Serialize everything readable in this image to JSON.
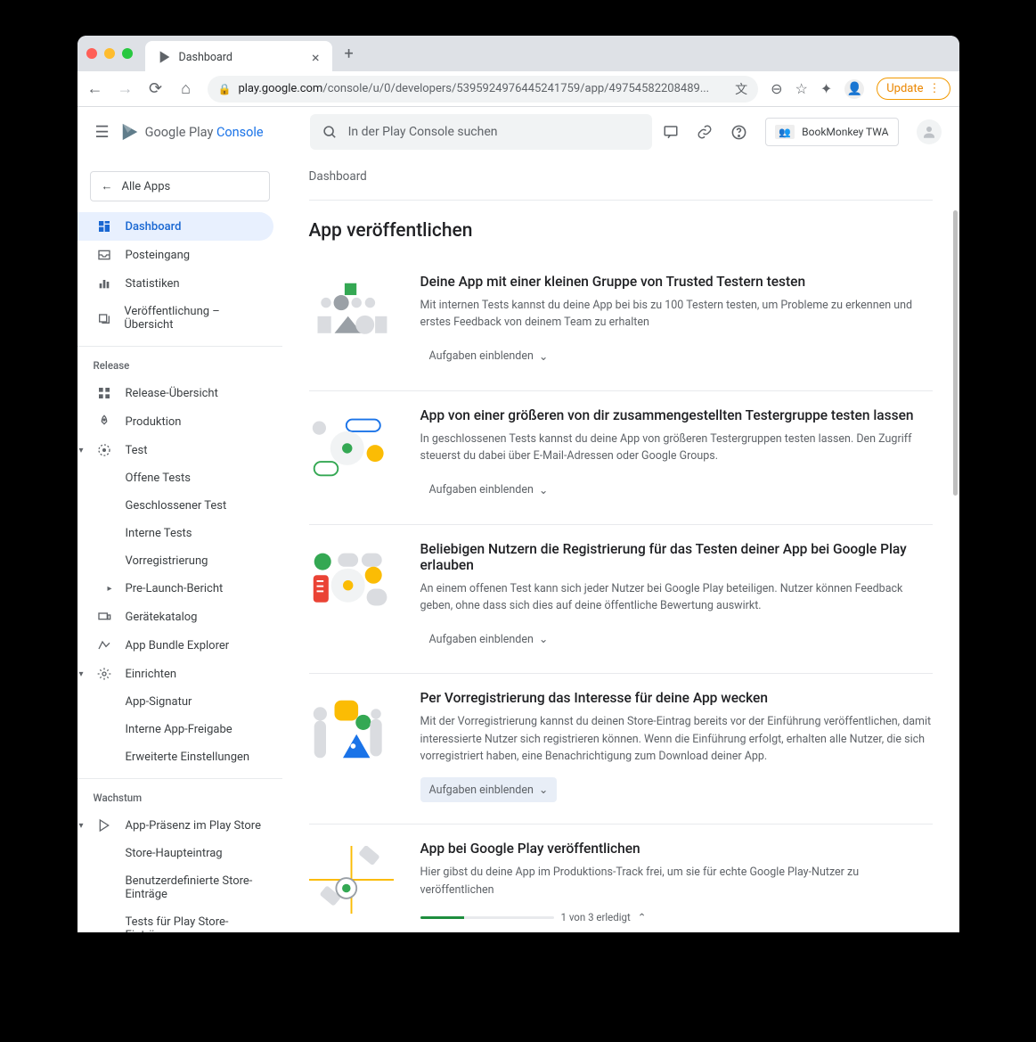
{
  "browser": {
    "tab_title": "Dashboard",
    "url_host": "play.google.com",
    "url_path": "/console/u/0/developers/539592497644524​1759/app/49754582208489...",
    "update_label": "Update"
  },
  "header": {
    "product_name": "Google Play",
    "product_suffix": "Console",
    "search_placeholder": "In der Play Console suchen",
    "app_chip": "BookMonkey TWA"
  },
  "sidebar": {
    "all_apps": "Alle Apps",
    "main": [
      {
        "icon": "dashboard",
        "label": "Dashboard",
        "active": true
      },
      {
        "icon": "inbox",
        "label": "Posteingang"
      },
      {
        "icon": "stats",
        "label": "Statistiken"
      },
      {
        "icon": "publish",
        "label": "Veröffentlichung – Übersicht"
      }
    ],
    "section_release": "Release",
    "release": [
      {
        "icon": "overview",
        "label": "Release-Übersicht"
      },
      {
        "icon": "rocket",
        "label": "Produktion"
      },
      {
        "icon": "test",
        "label": "Test",
        "expanded": true
      },
      {
        "sub": true,
        "label": "Offene Tests"
      },
      {
        "sub": true,
        "label": "Geschlossener Test"
      },
      {
        "sub": true,
        "label": "Interne Tests"
      },
      {
        "sub": true,
        "label": "Vorregistrierung"
      },
      {
        "sub": true,
        "label": "Pre-Launch-Bericht",
        "chevron": true
      },
      {
        "icon": "devices",
        "label": "Gerätekatalog"
      },
      {
        "icon": "bundle",
        "label": "App Bundle Explorer"
      },
      {
        "icon": "gear",
        "label": "Einrichten",
        "expanded": true
      },
      {
        "sub": true,
        "label": "App-Signatur"
      },
      {
        "sub": true,
        "label": "Interne App-Freigabe"
      },
      {
        "sub": true,
        "label": "Erweiterte Einstellungen"
      }
    ],
    "section_growth": "Wachstum",
    "growth": [
      {
        "icon": "play",
        "label": "App-Präsenz im Play Store",
        "expanded": true
      },
      {
        "sub": true,
        "label": "Store-Haupteintrag"
      },
      {
        "sub": true,
        "label": "Benutzerdefinierte Store-Einträge"
      },
      {
        "sub": true,
        "label": "Tests für Play Store-Einträge"
      }
    ]
  },
  "main": {
    "breadcrumb": "Dashboard",
    "page_title": "App veröffentlichen",
    "toggle_label": "Aufgaben einblenden",
    "cards": [
      {
        "title": "Deine App mit einer kleinen Gruppe von Trusted Testern testen",
        "desc": "Mit internen Tests kannst du deine App bei bis zu 100 Testern testen, um Probleme zu erkennen und erstes Feedback von deinem Team zu erhalten"
      },
      {
        "title": "App von einer größeren von dir zusammengestellten Testergruppe testen lassen",
        "desc": "In geschlossenen Tests kannst du deine App von größeren Testergruppen testen lassen. Den Zugriff steuerst du dabei über E-Mail-Adressen oder Google Groups."
      },
      {
        "title": "Beliebigen Nutzern die Registrierung für das Testen deiner App bei Google Play erlauben",
        "desc": "An einem offenen Test kann sich jeder Nutzer bei Google Play beteiligen. Nutzer können Feedback geben, ohne dass sich dies auf deine öffentliche Bewertung auswirkt."
      },
      {
        "title": "Per Vorregistrierung das Interesse für deine App wecken",
        "desc": "Mit der Vorregistrierung kannst du deinen Store-Eintrag bereits vor der Einführung veröffentlichen, damit interessierte Nutzer sich registrieren können. Wenn die Einführung erfolgt, erhalten alle Nutzer, die sich vorregistriert haben, eine Benachrichtigung zum Download deiner App.",
        "highlight": true
      },
      {
        "title": "App bei Google Play veröffentlichen",
        "desc": "Hier gibst du deine App im Produktions-Track frei, um sie für echte Google Play-Nutzer zu veröffentlichen",
        "progress": {
          "label": "1 von 3 erledigt",
          "done": 1,
          "total": 3
        }
      }
    ]
  }
}
